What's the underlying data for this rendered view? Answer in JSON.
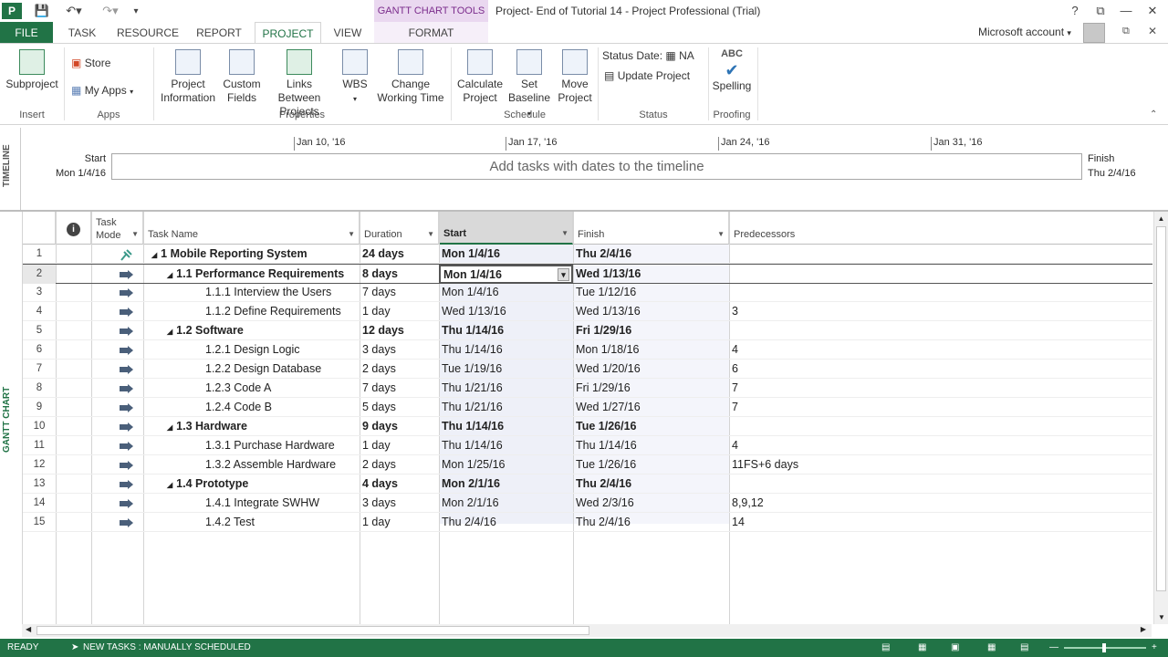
{
  "titlebar": {
    "contextual_tab": "GANTT CHART TOOLS",
    "window_title": "Project- End of Tutorial 14 - Project Professional (Trial)",
    "help": "?"
  },
  "tabs": [
    "FILE",
    "TASK",
    "RESOURCE",
    "REPORT",
    "PROJECT",
    "VIEW",
    "FORMAT"
  ],
  "account": "Microsoft account",
  "ribbon": {
    "insert": {
      "subproject": "Subproject",
      "group": "Insert"
    },
    "apps": {
      "store": "Store",
      "my_apps": "My Apps",
      "group": "Apps"
    },
    "properties": {
      "project_information": [
        "Project",
        "Information"
      ],
      "custom_fields": [
        "Custom",
        "Fields"
      ],
      "links_between": [
        "Links Between",
        "Projects"
      ],
      "wbs": "WBS",
      "change_working_time": [
        "Change",
        "Working Time"
      ],
      "group": "Properties"
    },
    "schedule": {
      "calculate": [
        "Calculate",
        "Project"
      ],
      "set_baseline": [
        "Set",
        "Baseline"
      ],
      "move_project": [
        "Move",
        "Project"
      ],
      "group": "Schedule"
    },
    "status": {
      "status_date_label": "Status Date:",
      "status_date_value": "NA",
      "update_project": "Update Project",
      "group": "Status"
    },
    "proofing": {
      "abc": "ABC",
      "spelling": "Spelling",
      "group": "Proofing"
    }
  },
  "timeline": {
    "label": "TIMELINE",
    "start_label": "Start",
    "start_date": "Mon 1/4/16",
    "finish_label": "Finish",
    "finish_date": "Thu 2/4/16",
    "placeholder": "Add tasks with dates to the timeline",
    "ticks": [
      "Jan 10, '16",
      "Jan 17, '16",
      "Jan 24, '16",
      "Jan 31, '16"
    ]
  },
  "side_label": "GANTT CHART",
  "columns": {
    "task_mode": [
      "Task",
      "Mode"
    ],
    "task_name": "Task Name",
    "duration": "Duration",
    "start": "Start",
    "finish": "Finish",
    "predecessors": "Predecessors"
  },
  "rows": [
    {
      "id": "1",
      "name": "1 Mobile Reporting System",
      "duration": "24 days",
      "start": "Mon 1/4/16",
      "finish": "Thu 2/4/16",
      "pred": "",
      "level": 0,
      "summary": true,
      "manual": true
    },
    {
      "id": "2",
      "name": "1.1 Performance Requirements",
      "duration": "8 days",
      "start": "Mon 1/4/16",
      "finish": "Wed 1/13/16",
      "pred": "",
      "level": 1,
      "summary": true
    },
    {
      "id": "3",
      "name": "1.1.1 Interview the Users",
      "duration": "7 days",
      "start": "Mon 1/4/16",
      "finish": "Tue 1/12/16",
      "pred": "",
      "level": 2
    },
    {
      "id": "4",
      "name": "1.1.2 Define Requirements",
      "duration": "1 day",
      "start": "Wed 1/13/16",
      "finish": "Wed 1/13/16",
      "pred": "3",
      "level": 2
    },
    {
      "id": "5",
      "name": "1.2 Software",
      "duration": "12 days",
      "start": "Thu 1/14/16",
      "finish": "Fri 1/29/16",
      "pred": "",
      "level": 1,
      "summary": true
    },
    {
      "id": "6",
      "name": "1.2.1 Design Logic",
      "duration": "3 days",
      "start": "Thu 1/14/16",
      "finish": "Mon 1/18/16",
      "pred": "4",
      "level": 2
    },
    {
      "id": "7",
      "name": "1.2.2 Design Database",
      "duration": "2 days",
      "start": "Tue 1/19/16",
      "finish": "Wed 1/20/16",
      "pred": "6",
      "level": 2
    },
    {
      "id": "8",
      "name": "1.2.3 Code A",
      "duration": "7 days",
      "start": "Thu 1/21/16",
      "finish": "Fri 1/29/16",
      "pred": "7",
      "level": 2
    },
    {
      "id": "9",
      "name": "1.2.4 Code B",
      "duration": "5 days",
      "start": "Thu 1/21/16",
      "finish": "Wed 1/27/16",
      "pred": "7",
      "level": 2
    },
    {
      "id": "10",
      "name": "1.3 Hardware",
      "duration": "9 days",
      "start": "Thu 1/14/16",
      "finish": "Tue 1/26/16",
      "pred": "",
      "level": 1,
      "summary": true
    },
    {
      "id": "11",
      "name": "1.3.1 Purchase Hardware",
      "duration": "1 day",
      "start": "Thu 1/14/16",
      "finish": "Thu 1/14/16",
      "pred": "4",
      "level": 2
    },
    {
      "id": "12",
      "name": "1.3.2 Assemble Hardware",
      "duration": "2 days",
      "start": "Mon 1/25/16",
      "finish": "Tue 1/26/16",
      "pred": "11FS+6 days",
      "level": 2
    },
    {
      "id": "13",
      "name": "1.4 Prototype",
      "duration": "4 days",
      "start": "Mon 2/1/16",
      "finish": "Thu 2/4/16",
      "pred": "",
      "level": 1,
      "summary": true
    },
    {
      "id": "14",
      "name": "1.4.1 Integrate SWHW",
      "duration": "3 days",
      "start": "Mon 2/1/16",
      "finish": "Wed 2/3/16",
      "pred": "8,9,12",
      "level": 2
    },
    {
      "id": "15",
      "name": "1.4.2 Test",
      "duration": "1 day",
      "start": "Thu 2/4/16",
      "finish": "Thu 2/4/16",
      "pred": "14",
      "level": 2
    }
  ],
  "status_bar": {
    "ready": "READY",
    "new_tasks": "NEW TASKS : MANUALLY SCHEDULED"
  },
  "colors": {
    "accent": "#217346",
    "contextual": "#7b2c8c",
    "start_col_bg": "#eef0f8",
    "selected_header": "#d9d9d9"
  }
}
